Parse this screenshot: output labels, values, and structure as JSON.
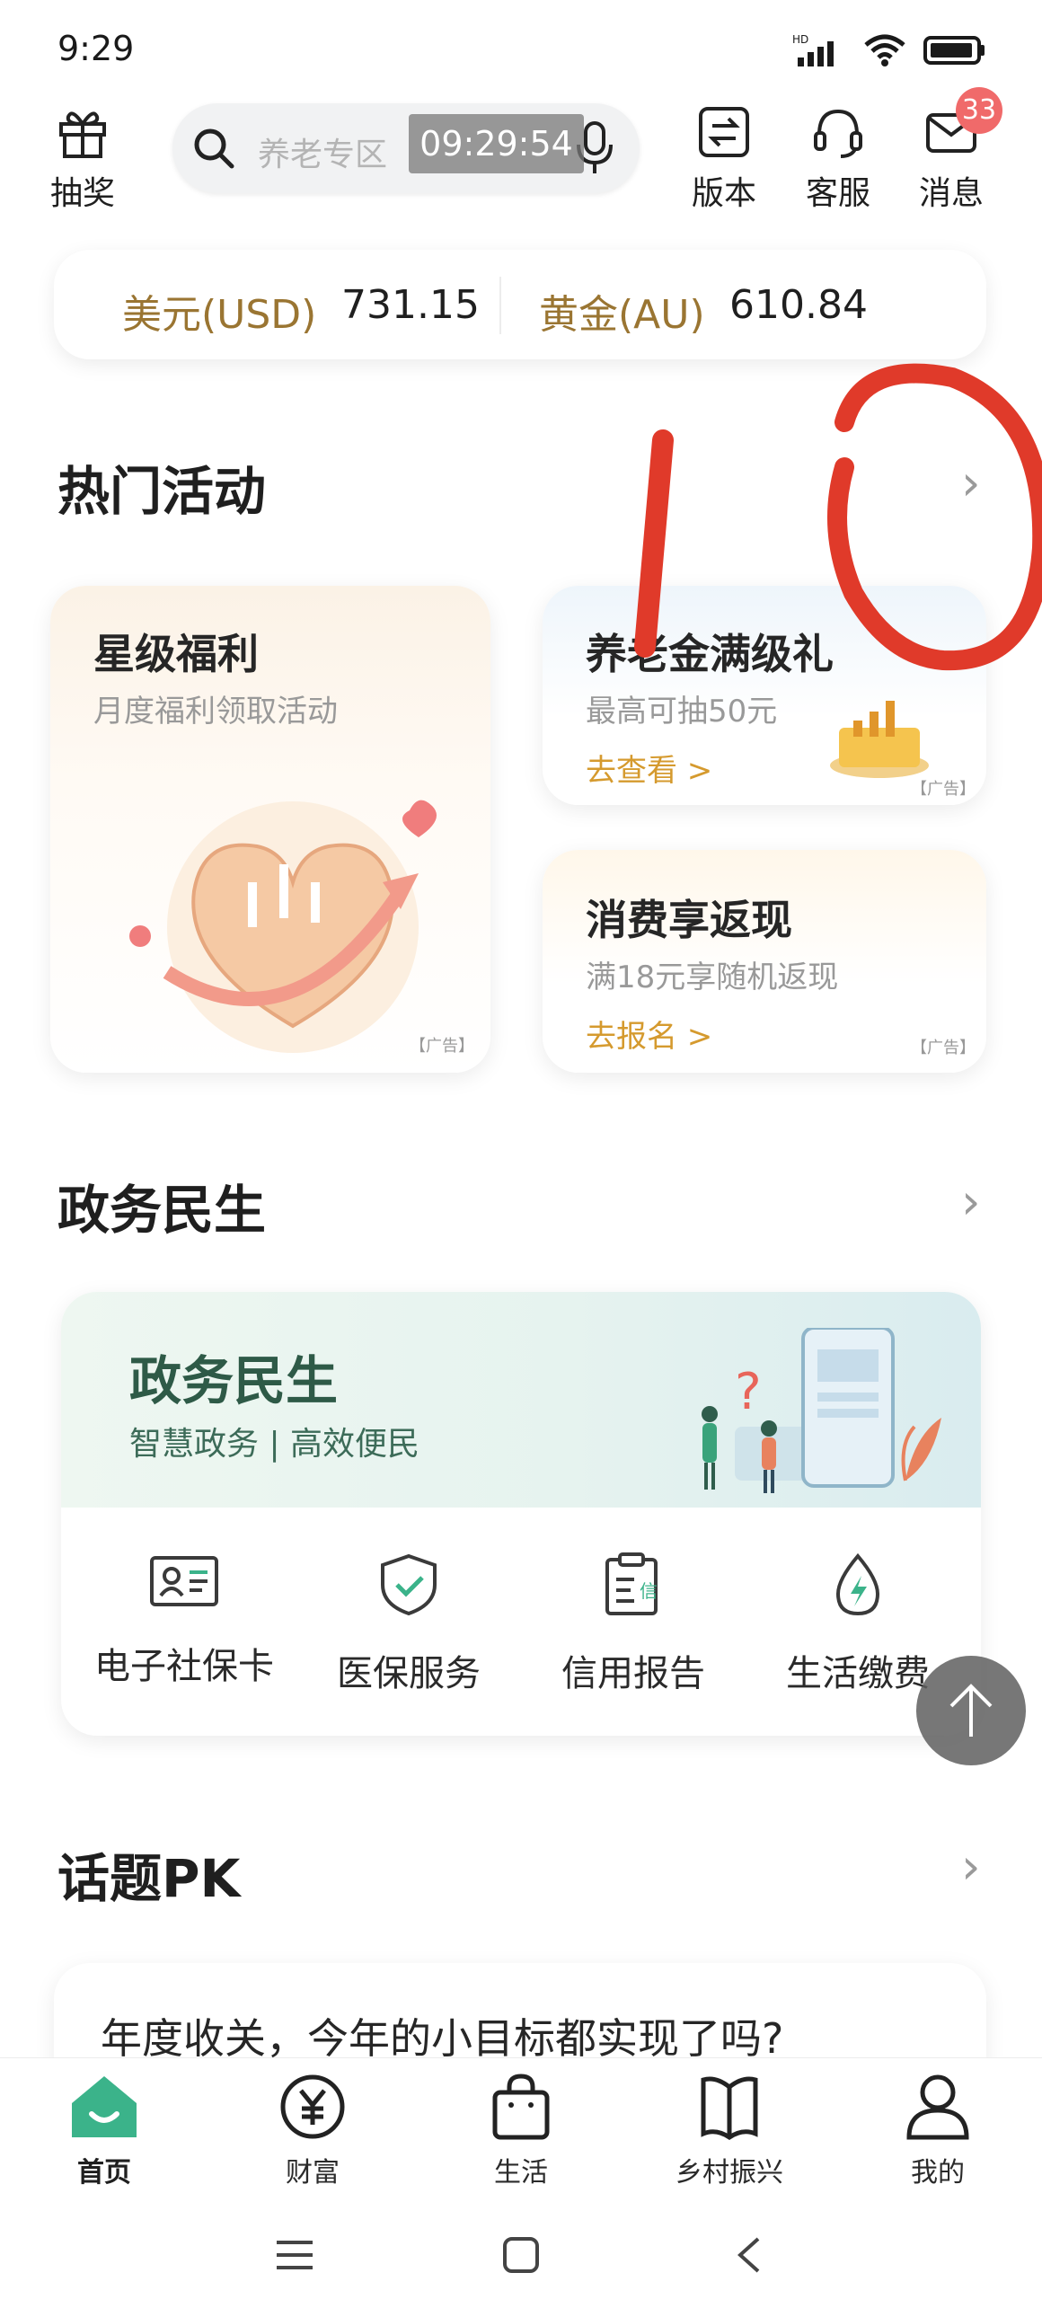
{
  "status_bar": {
    "time": "9:29",
    "network": "HD"
  },
  "header": {
    "lottery_label": "抽奖",
    "search_placeholder": "养老专区",
    "clock_overlay": "09:29:54",
    "version_label": "版本",
    "service_label": "客服",
    "messages_label": "消息",
    "messages_badge": "33"
  },
  "rates": {
    "usd_name": "美元(USD)",
    "usd_value": "731.15",
    "gold_name": "黄金(AU)",
    "gold_value": "610.84"
  },
  "hot_activities": {
    "title": "热门活动",
    "card_star": {
      "title": "星级福利",
      "subtitle": "月度福利领取活动",
      "ad": "【广告】"
    },
    "card_pension": {
      "title": "养老金满级礼",
      "subtitle": "最高可抽50元",
      "action": "去查看 >",
      "ad": "【广告】"
    },
    "card_cashback": {
      "title": "消费享返现",
      "subtitle": "满18元享随机返现",
      "action": "去报名 >",
      "ad": "【广告】"
    }
  },
  "gov": {
    "title": "政务民生",
    "banner_title": "政务民生",
    "banner_subtitle": "智慧政务 | 高效便民",
    "services": [
      {
        "label": "电子社保卡",
        "icon": "id-card-icon"
      },
      {
        "label": "医保服务",
        "icon": "shield-check-icon"
      },
      {
        "label": "信用报告",
        "icon": "clipboard-credit-icon"
      },
      {
        "label": "生活缴费",
        "icon": "drop-bolt-icon"
      }
    ]
  },
  "topic": {
    "title": "话题PK",
    "question": "年度收关，今年的小目标都实现了吗?"
  },
  "bottom_nav": {
    "items": [
      {
        "label": "首页",
        "icon": "home-icon",
        "active": true
      },
      {
        "label": "财富",
        "icon": "yuan-icon"
      },
      {
        "label": "生活",
        "icon": "bag-icon"
      },
      {
        "label": "乡村振兴",
        "icon": "book-icon"
      },
      {
        "label": "我的",
        "icon": "person-icon"
      }
    ]
  },
  "colors": {
    "accent_green": "#3bb38a",
    "gold_text": "#9a7532",
    "action_gold": "#d59a2e",
    "badge_red": "#f06a6a",
    "handwriting_red": "#e03a2a"
  }
}
